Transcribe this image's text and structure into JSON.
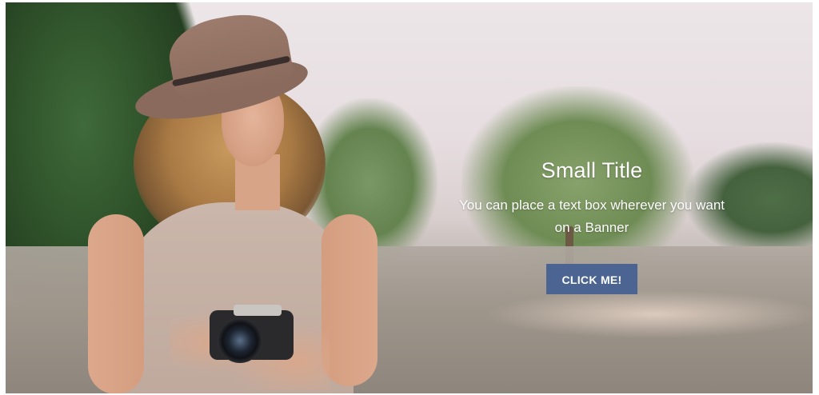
{
  "banner": {
    "title": "Small Title",
    "text": "You can place a text box wherever you want on a Banner",
    "button_label": "CLICK ME!",
    "button_color": "#4b6491",
    "text_color": "#ffffff"
  }
}
